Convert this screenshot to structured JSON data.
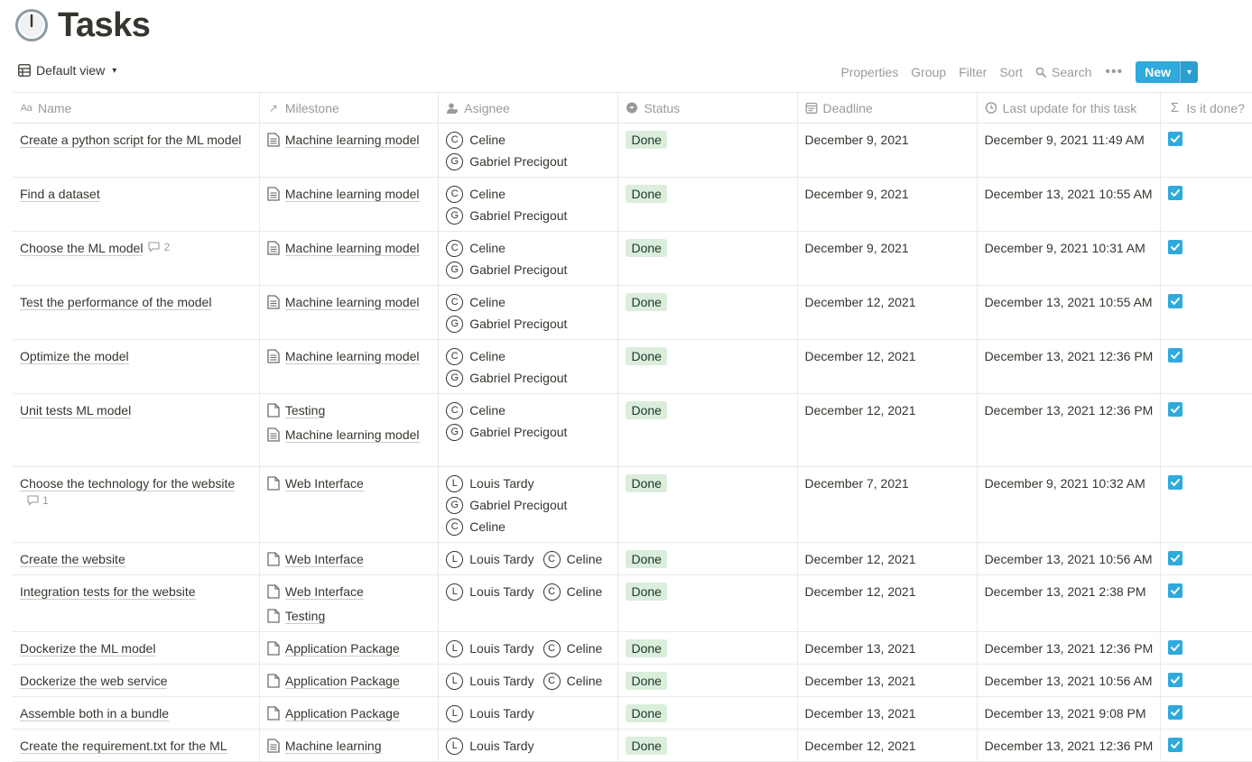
{
  "page": {
    "title": "Tasks",
    "title_icon": "clock-icon"
  },
  "toolbar": {
    "view_label": "Default view",
    "properties_label": "Properties",
    "group_label": "Group",
    "filter_label": "Filter",
    "sort_label": "Sort",
    "search_label": "Search",
    "more_label": "•••",
    "new_label": "New"
  },
  "columns": {
    "name": "Name",
    "milestone": "Milestone",
    "assignee": "Asignee",
    "status": "Status",
    "deadline": "Deadline",
    "last_update": "Last update for this task",
    "is_done": "Is it done?"
  },
  "colors": {
    "accent": "#2eaadc",
    "status_done_bg": "#dbeddb",
    "status_done_fg": "#1c3829"
  },
  "rows": [
    {
      "name": "Create a python script for the ML model",
      "milestones": [
        {
          "label": "Machine learning model",
          "icon": "doc-lines-icon"
        }
      ],
      "assignees": [
        {
          "initial": "C",
          "name": "Celine"
        },
        {
          "initial": "G",
          "name": "Gabriel Precigout"
        }
      ],
      "status": "Done",
      "deadline": "December 9, 2021",
      "last_update": "December 9, 2021 11:49 AM",
      "done": true,
      "comments": ""
    },
    {
      "name": "Find a dataset",
      "milestones": [
        {
          "label": "Machine learning model",
          "icon": "doc-lines-icon"
        }
      ],
      "assignees": [
        {
          "initial": "C",
          "name": "Celine"
        },
        {
          "initial": "G",
          "name": "Gabriel Precigout"
        }
      ],
      "status": "Done",
      "deadline": "December 9, 2021",
      "last_update": "December 13, 2021 10:55 AM",
      "done": true,
      "comments": ""
    },
    {
      "name": "Choose the ML model",
      "milestones": [
        {
          "label": "Machine learning model",
          "icon": "doc-lines-icon"
        }
      ],
      "assignees": [
        {
          "initial": "C",
          "name": "Celine"
        },
        {
          "initial": "G",
          "name": "Gabriel Precigout"
        }
      ],
      "status": "Done",
      "deadline": "December 9, 2021",
      "last_update": "December 9, 2021 10:31 AM",
      "done": true,
      "comments": "2"
    },
    {
      "name": "Test the performance of the model",
      "milestones": [
        {
          "label": "Machine learning model",
          "icon": "doc-lines-icon"
        }
      ],
      "assignees": [
        {
          "initial": "C",
          "name": "Celine"
        },
        {
          "initial": "G",
          "name": "Gabriel Precigout"
        }
      ],
      "status": "Done",
      "deadline": "December 12, 2021",
      "last_update": "December 13, 2021 10:55 AM",
      "done": true,
      "comments": ""
    },
    {
      "name": "Optimize the model",
      "milestones": [
        {
          "label": "Machine learning model",
          "icon": "doc-lines-icon"
        }
      ],
      "assignees": [
        {
          "initial": "C",
          "name": "Celine"
        },
        {
          "initial": "G",
          "name": "Gabriel Precigout"
        }
      ],
      "status": "Done",
      "deadline": "December 12, 2021",
      "last_update": "December 13, 2021 12:36 PM",
      "done": true,
      "comments": ""
    },
    {
      "name": "Unit tests ML model",
      "milestones": [
        {
          "label": "Testing",
          "icon": "doc-icon"
        },
        {
          "label": "Machine learning model",
          "icon": "doc-lines-icon"
        }
      ],
      "assignees": [
        {
          "initial": "C",
          "name": "Celine"
        },
        {
          "initial": "G",
          "name": "Gabriel Precigout"
        }
      ],
      "status": "Done",
      "deadline": "December 12, 2021",
      "last_update": "December 13, 2021 12:36 PM",
      "done": true,
      "comments": ""
    },
    {
      "name": "Choose the technology for the website",
      "milestones": [
        {
          "label": "Web Interface",
          "icon": "doc-icon"
        }
      ],
      "assignees": [
        {
          "initial": "L",
          "name": "Louis Tardy"
        },
        {
          "initial": "G",
          "name": "Gabriel Precigout"
        },
        {
          "initial": "C",
          "name": "Celine"
        }
      ],
      "status": "Done",
      "deadline": "December 7, 2021",
      "last_update": "December 9, 2021 10:32 AM",
      "done": true,
      "comments": "1",
      "comments_below": true
    },
    {
      "name": "Create the website",
      "milestones": [
        {
          "label": "Web Interface",
          "icon": "doc-icon"
        }
      ],
      "assignees": [
        {
          "initial": "L",
          "name": "Louis Tardy"
        },
        {
          "initial": "C",
          "name": "Celine"
        }
      ],
      "status": "Done",
      "deadline": "December 12, 2021",
      "last_update": "December 13, 2021 10:56 AM",
      "done": true,
      "comments": ""
    },
    {
      "name": "Integration tests for the website",
      "milestones": [
        {
          "label": "Web Interface",
          "icon": "doc-icon"
        },
        {
          "label": "Testing",
          "icon": "doc-icon"
        }
      ],
      "assignees": [
        {
          "initial": "L",
          "name": "Louis Tardy"
        },
        {
          "initial": "C",
          "name": "Celine"
        }
      ],
      "status": "Done",
      "deadline": "December 12, 2021",
      "last_update": "December 13, 2021 2:38 PM",
      "done": true,
      "comments": ""
    },
    {
      "name": "Dockerize the ML model",
      "milestones": [
        {
          "label": "Application Package",
          "icon": "doc-icon"
        }
      ],
      "assignees": [
        {
          "initial": "L",
          "name": "Louis Tardy"
        },
        {
          "initial": "C",
          "name": "Celine"
        }
      ],
      "status": "Done",
      "deadline": "December 13, 2021",
      "last_update": "December 13, 2021 12:36 PM",
      "done": true,
      "comments": ""
    },
    {
      "name": "Dockerize the web service",
      "milestones": [
        {
          "label": "Application Package",
          "icon": "doc-icon"
        }
      ],
      "assignees": [
        {
          "initial": "L",
          "name": "Louis Tardy"
        },
        {
          "initial": "C",
          "name": "Celine"
        }
      ],
      "status": "Done",
      "deadline": "December 13, 2021",
      "last_update": "December 13, 2021 10:56 AM",
      "done": true,
      "comments": ""
    },
    {
      "name": "Assemble both in a bundle",
      "milestones": [
        {
          "label": "Application Package",
          "icon": "doc-icon"
        }
      ],
      "assignees": [
        {
          "initial": "L",
          "name": "Louis Tardy"
        }
      ],
      "status": "Done",
      "deadline": "December 13, 2021",
      "last_update": "December 13, 2021 9:08 PM",
      "done": true,
      "comments": ""
    },
    {
      "name": "Create the requirement.txt for the ML",
      "milestones": [
        {
          "label": "Machine learning",
          "icon": "doc-lines-icon"
        }
      ],
      "assignees": [
        {
          "initial": "L",
          "name": "Louis Tardy"
        }
      ],
      "status": "Done",
      "deadline": "December 12, 2021",
      "last_update": "December 13, 2021 12:36 PM",
      "done": true,
      "comments": ""
    }
  ]
}
